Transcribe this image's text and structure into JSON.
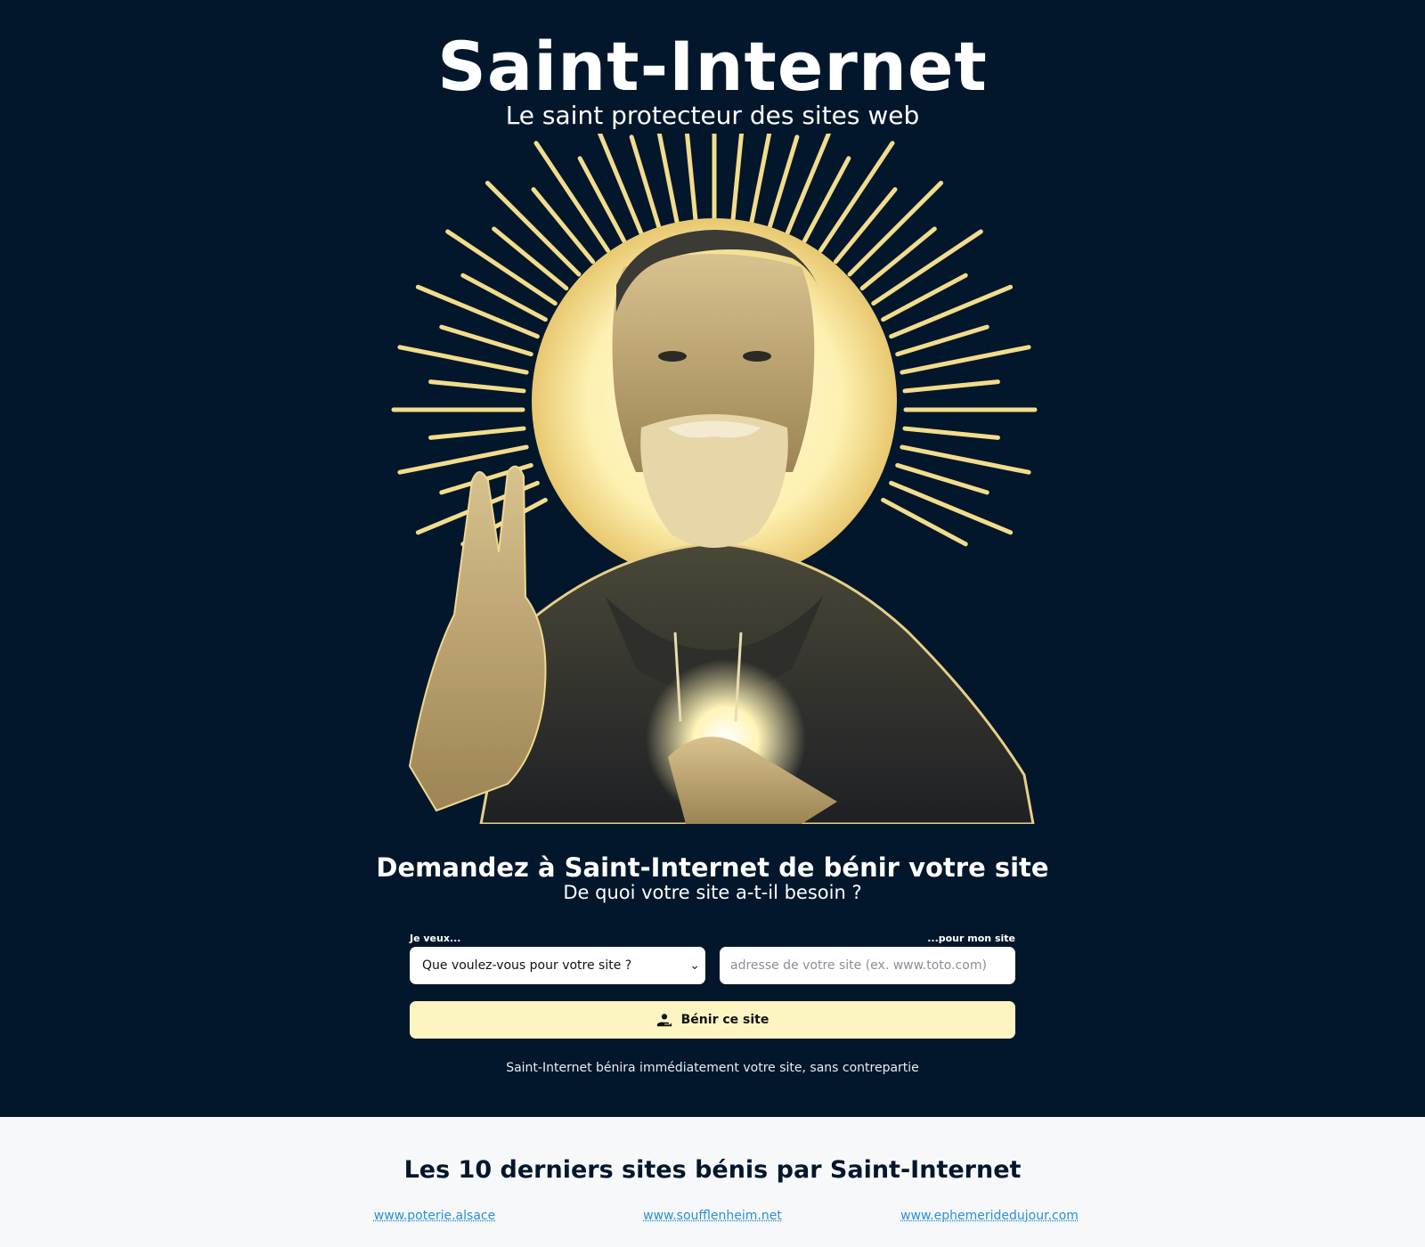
{
  "header": {
    "title": "Saint-Internet",
    "subtitle": "Le saint protecteur des sites web"
  },
  "form": {
    "heading": "Demandez à Saint-Internet de bénir votre site",
    "subheading": "De quoi votre site a-t-il besoin ?",
    "want_label": "Je veux...",
    "for_label": "...pour mon site",
    "select_value": "Que voulez-vous pour votre site ?",
    "url_placeholder": "adresse de votre site (ex. www.toto.com)",
    "button_label": "Bénir ce site",
    "note": "Saint-Internet bénira immédiatement votre site, sans contrepartie"
  },
  "recent": {
    "title": "Les 10 derniers sites bénis par Saint-Internet",
    "links": [
      "www.poterie.alsace",
      "www.soufflenheim.net",
      "www.ephemeridedujour.com"
    ]
  },
  "colors": {
    "background": "#02172c",
    "button": "#fdf5c1",
    "link": "#2a8fd6"
  }
}
